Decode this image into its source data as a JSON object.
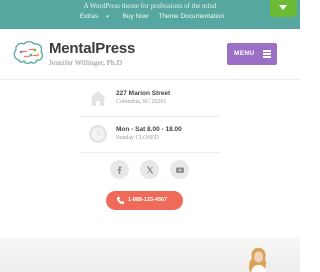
{
  "topbar": {
    "tagline": "A WordPress theme for professions of the mind",
    "nav": [
      {
        "label": "Extras",
        "has_caret": true
      },
      {
        "label": "Buy Now"
      },
      {
        "label": "Theme Documentation"
      }
    ],
    "accent_color": "#56a79f",
    "toggle_color": "#6dbb35"
  },
  "header": {
    "brand": "MentalPress",
    "subtitle": "Jennifer Willinger, Ph.D",
    "menu_label": "MENU",
    "menu_color": "#9a6fc5"
  },
  "info": {
    "address": {
      "title": "227 Marion Street",
      "sub": "Columbia, SC 29201",
      "icon": "home-icon"
    },
    "hours": {
      "title": "Mon - Sat 8.00 - 18.00",
      "sub": "Sunday CLOSED",
      "icon": "clock-icon"
    }
  },
  "socials": [
    {
      "name": "facebook-icon",
      "glyph": "f"
    },
    {
      "name": "x-twitter-icon",
      "glyph": "𝕏"
    },
    {
      "name": "youtube-icon",
      "glyph": "You"
    }
  ],
  "cta": {
    "phone": "1-888-123-4567",
    "icon": "phone-icon",
    "color": "#ef6a58"
  }
}
